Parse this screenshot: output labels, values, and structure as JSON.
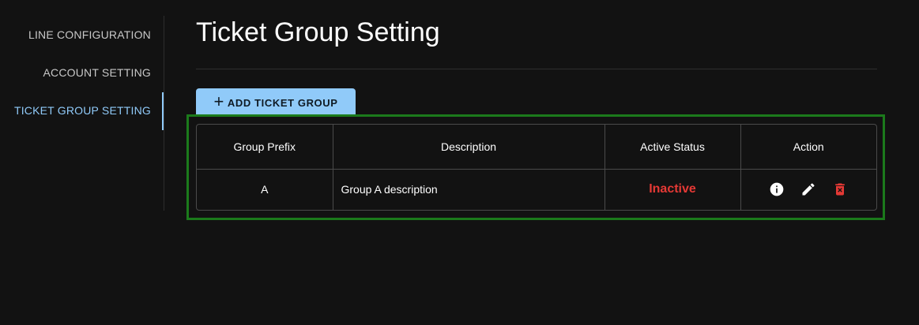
{
  "sidebar": {
    "items": [
      {
        "label": "LINE CONFIGURATION"
      },
      {
        "label": "ACCOUNT SETTING"
      },
      {
        "label": "TICKET GROUP SETTING"
      }
    ]
  },
  "page": {
    "title": "Ticket Group Setting"
  },
  "toolbar": {
    "add_label": "ADD TICKET GROUP"
  },
  "table": {
    "headers": {
      "prefix": "Group Prefix",
      "description": "Description",
      "status": "Active Status",
      "action": "Action"
    },
    "rows": [
      {
        "prefix": "A",
        "description": "Group A description",
        "status": "Inactive"
      }
    ]
  },
  "colors": {
    "accent": "#90caf9",
    "background": "#121212",
    "inactive": "#e53935",
    "highlight": "#1b7a1b"
  },
  "icons": [
    "plus-icon",
    "info-icon",
    "edit-icon",
    "delete-icon"
  ]
}
